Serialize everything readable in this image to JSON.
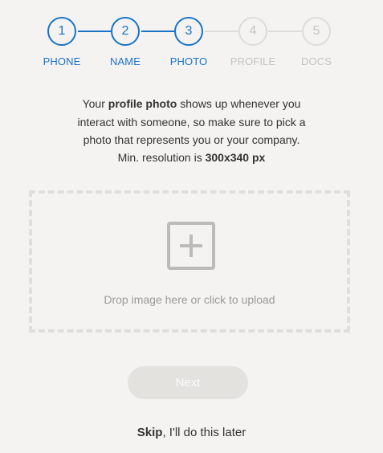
{
  "stepper": {
    "steps": [
      {
        "number": "1",
        "label": "PHONE",
        "state": "complete"
      },
      {
        "number": "2",
        "label": "NAME",
        "state": "complete"
      },
      {
        "number": "3",
        "label": "PHOTO",
        "state": "current"
      },
      {
        "number": "4",
        "label": "PROFILE",
        "state": "upcoming"
      },
      {
        "number": "5",
        "label": "DOCS",
        "state": "upcoming"
      }
    ],
    "active_color": "#1a73c8",
    "inactive_color": "#dedcd8"
  },
  "intro": {
    "prefix": "Your ",
    "emphasis": "profile photo",
    "suffix": " shows up whenever you interact with someone, so make sure to pick a photo that represents you or your company."
  },
  "resolution": {
    "prefix": "Min. resolution is ",
    "value": "300x340 px"
  },
  "dropzone": {
    "icon": "add-image-icon",
    "text": "Drop image here or click to upload"
  },
  "next_button": {
    "label": "Next",
    "enabled": false
  },
  "skip": {
    "link_text": "Skip",
    "rest_text": ", I'll do this later"
  }
}
